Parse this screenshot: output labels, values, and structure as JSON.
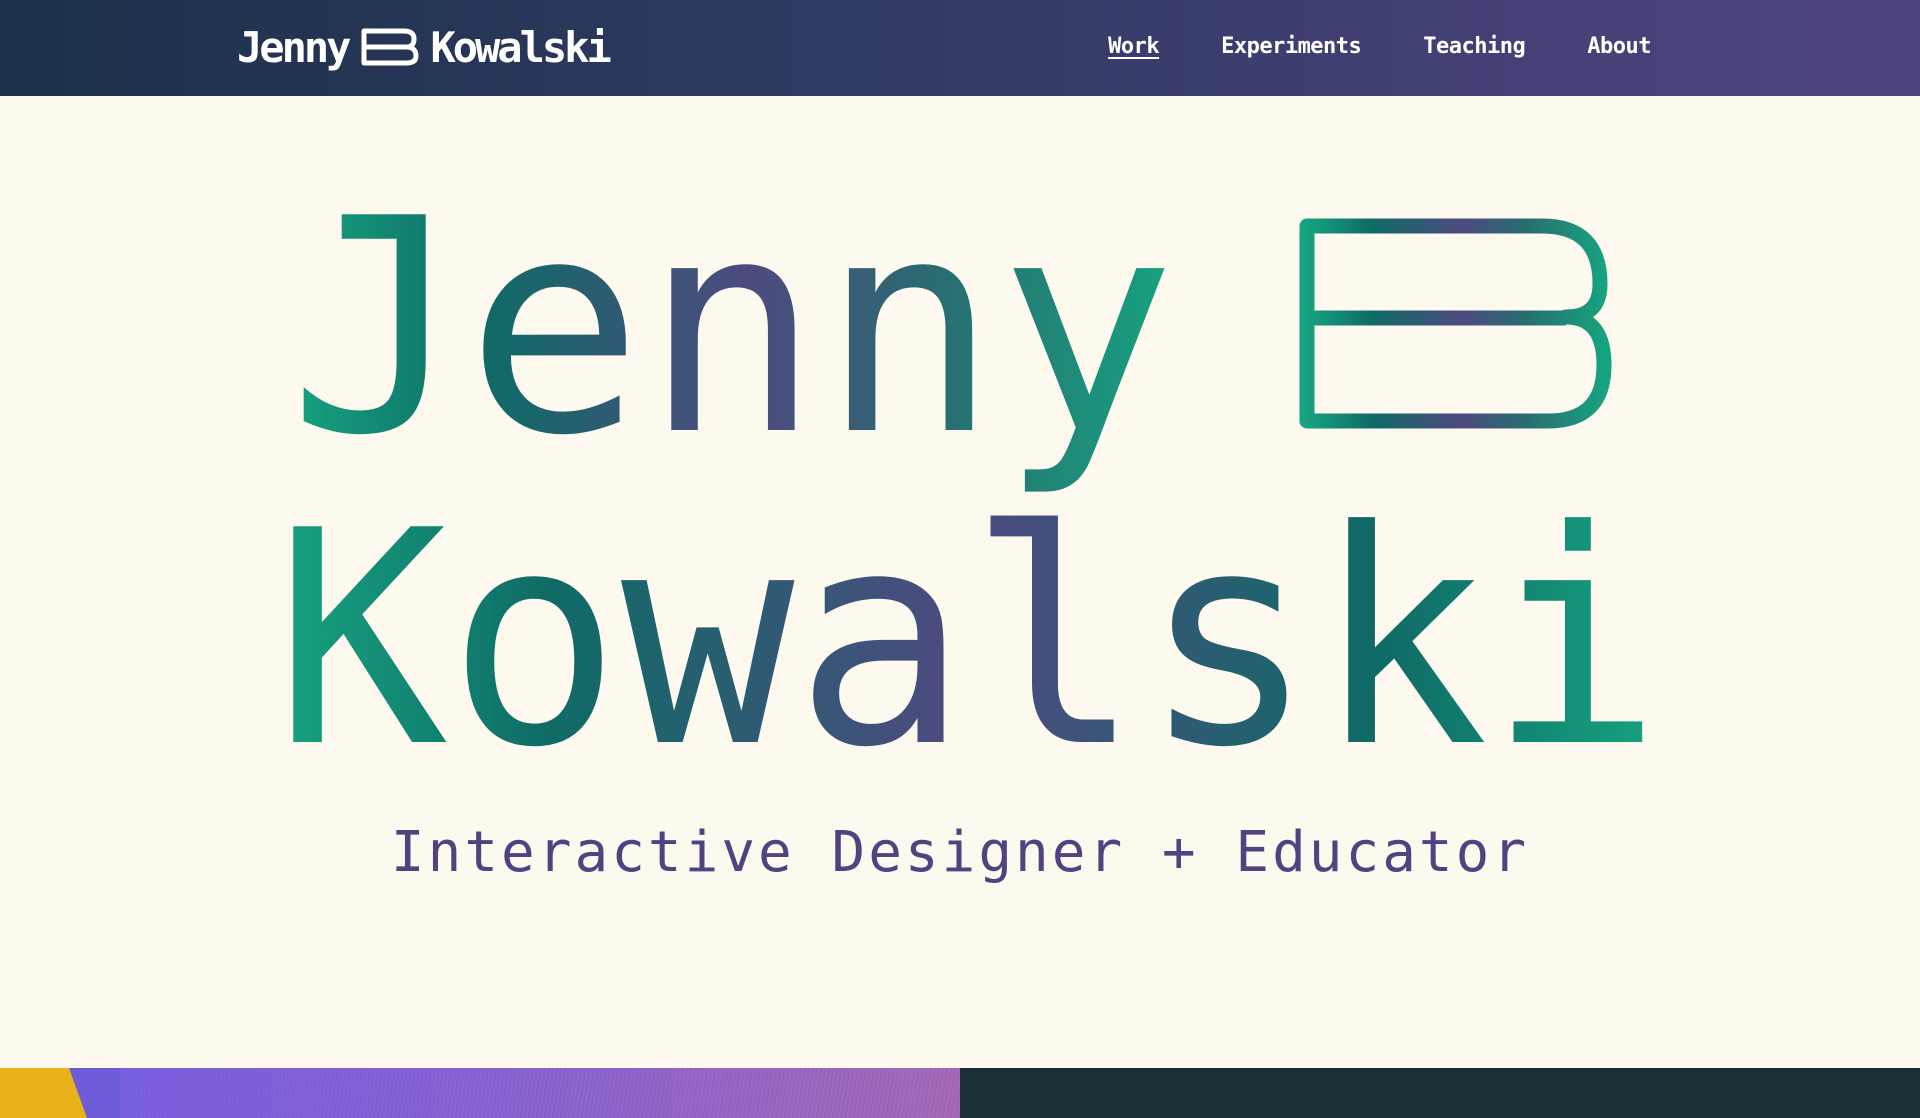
{
  "header": {
    "logo": {
      "first": "Jenny",
      "middle_initial": "B",
      "last": "Kowalski"
    },
    "nav": [
      {
        "label": "Work",
        "active": true
      },
      {
        "label": "Experiments",
        "active": false
      },
      {
        "label": "Teaching",
        "active": false
      },
      {
        "label": "About",
        "active": false
      }
    ]
  },
  "hero": {
    "line1": "Jenny",
    "line1_initial": "B",
    "line2": "Kowalski",
    "tagline": "Interactive Designer + Educator"
  },
  "colors": {
    "header_start": "#1b3149",
    "header_end": "#4e4580",
    "page_background": "#fdf9ef",
    "gradient_green": "#16a37f",
    "gradient_teal": "#0f6b66",
    "gradient_purple": "#4e4a80",
    "tagline": "#4e4580",
    "footer_dark": "#1b2f36",
    "accent_yellow": "#e9b21a"
  }
}
